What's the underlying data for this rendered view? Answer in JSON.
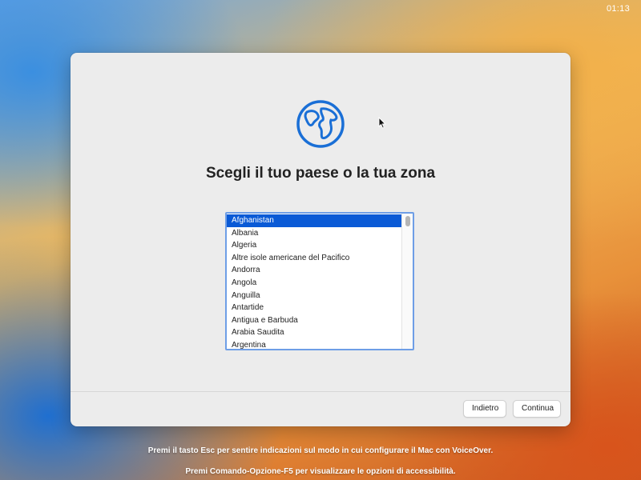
{
  "menubar": {
    "clock": "01:13"
  },
  "dialog": {
    "title": "Scegli il tuo paese o la tua zona",
    "icon": "globe-icon",
    "countries": [
      "Afghanistan",
      "Albania",
      "Algeria",
      "Altre isole americane del Pacifico",
      "Andorra",
      "Angola",
      "Anguilla",
      "Antartide",
      "Antigua e Barbuda",
      "Arabia Saudita",
      "Argentina"
    ],
    "selected": "Afghanistan",
    "buttons": {
      "back": "Indietro",
      "continue": "Continua"
    }
  },
  "hints": {
    "voiceover": "Premi il tasto Esc per sentire indicazioni sul modo in cui configurare il Mac con VoiceOver.",
    "accessibility": "Premi Comando-Opzione-F5 per visualizzare le opzioni di accessibilità."
  },
  "colors": {
    "accent": "#0a5ad6",
    "globe": "#1a6fd6"
  }
}
